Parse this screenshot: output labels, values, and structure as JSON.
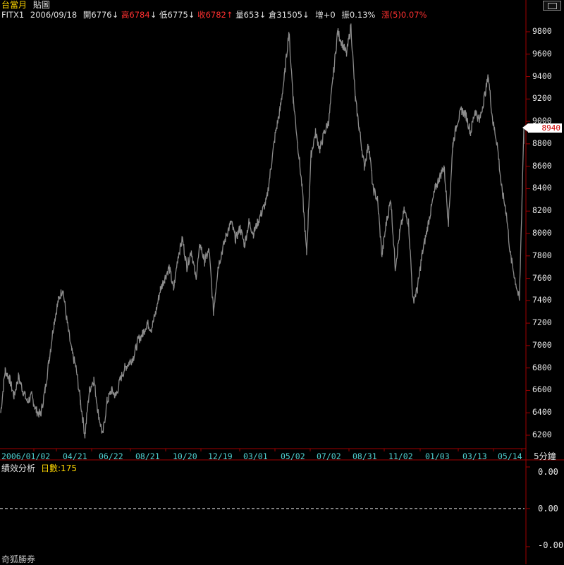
{
  "title_bar": {
    "instrument": "台當月",
    "mode": "貼圖"
  },
  "quote_bar": {
    "symbol": "FITX1",
    "date": "2006/09/18",
    "open_label": "開",
    "open_value": "6776",
    "high_label": "高",
    "high_value": "6784",
    "low_label": "低",
    "low_value": "6775",
    "close_label": "收",
    "close_value": "6782",
    "volume_label": "量",
    "volume_value": "653",
    "oi_label": "倉",
    "oi_value": "31505",
    "increase_label": "增",
    "increase_value": "+0",
    "amplitude_label": "振",
    "amplitude_value": "0.13%",
    "change_label": "漲(5)",
    "change_value": "0.07%",
    "arrow_down": "↓",
    "arrow_up": "↑"
  },
  "main_chart": {
    "y_ticks": [
      "9800",
      "9600",
      "9400",
      "9200",
      "9000",
      "8800",
      "8600",
      "8400",
      "8200",
      "8000",
      "7800",
      "7600",
      "7400",
      "7200",
      "7000",
      "6800",
      "6600",
      "6400",
      "6200"
    ],
    "x_ticks": [
      "2006/01/02",
      "04/21",
      "06/22",
      "08/21",
      "10/20",
      "12/19",
      "03/01",
      "05/02",
      "07/02",
      "08/31",
      "11/02",
      "01/03",
      "03/13",
      "05/14"
    ],
    "interval_label": "5分鐘",
    "last_price": "8940",
    "colors": {
      "price_line": "#8c8c8c",
      "axis_red": "#a00000",
      "tick_text": "#4fd0d0",
      "last_price_bg": "#ffffff",
      "last_price_text": "#d00000"
    }
  },
  "chart_data": {
    "type": "line",
    "x_ticks": [
      "2006/01/02",
      "04/21",
      "06/22",
      "08/21",
      "10/20",
      "12/19",
      "03/01",
      "05/02",
      "07/02",
      "08/31",
      "11/02",
      "01/03",
      "03/13",
      "05/14"
    ],
    "ylim": [
      6100,
      9900
    ],
    "y_ticks": [
      6200,
      6400,
      6600,
      6800,
      7000,
      7200,
      7400,
      7600,
      7800,
      8000,
      8200,
      8400,
      8600,
      8800,
      9000,
      9200,
      9400,
      9600,
      9800
    ],
    "series": [
      {
        "values": [
          6400,
          6780,
          6700,
          6550,
          6720,
          6600,
          6500,
          6550,
          6420,
          6380,
          6600,
          6900,
          7200,
          7400,
          7510,
          7200,
          6950,
          6800,
          6500,
          6200,
          6600,
          6700,
          6400,
          6200,
          6500,
          6600,
          6550,
          6700,
          6800,
          6850,
          6900,
          7050,
          7100,
          7200,
          7150,
          7300,
          7500,
          7600,
          7700,
          7500,
          7800,
          7950,
          7700,
          7850,
          7600,
          7900,
          7750,
          7850,
          7300,
          7700,
          7850,
          8000,
          8100,
          7950,
          8050,
          7900,
          8100,
          8000,
          8100,
          8200,
          8300,
          8600,
          8900,
          9100,
          9400,
          9800,
          9200,
          8800,
          8400,
          7820,
          8700,
          8900,
          8750,
          8900,
          9000,
          9400,
          9800,
          9700,
          9600,
          9850,
          9200,
          8900,
          8600,
          8800,
          8400,
          8300,
          7800,
          8100,
          8300,
          7700,
          8000,
          8200,
          8100,
          7400,
          7500,
          7800,
          8000,
          8200,
          8400,
          8500,
          8600,
          8100,
          8800,
          9000,
          9100,
          9050,
          8900,
          9100,
          9000,
          9200,
          9400,
          9000,
          8800,
          8400,
          8200,
          7800,
          7600,
          7400,
          8940
        ]
      }
    ]
  },
  "sub_chart": {
    "title": "績效分析",
    "days_label": "日數:175",
    "values": [
      "0.00",
      "0.00",
      "-0.00"
    ],
    "colors": {
      "zero_line": "#ffffff"
    }
  },
  "footer": {
    "label": "奇狐勝券"
  }
}
